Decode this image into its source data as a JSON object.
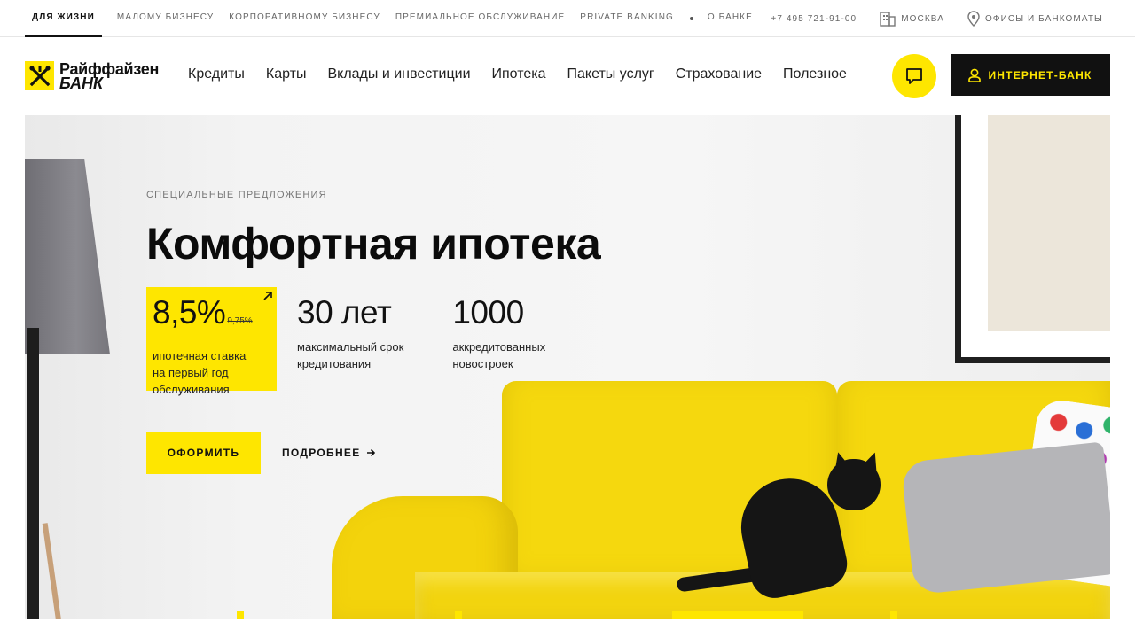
{
  "topbar": {
    "nav": [
      {
        "label": "Для жизни",
        "active": true
      },
      {
        "label": "Малому бизнесу"
      },
      {
        "label": "Корпоративному бизнесу"
      },
      {
        "label": "Премиальное обслуживание"
      },
      {
        "label": "Private Banking"
      },
      {
        "label": "О банке"
      }
    ],
    "phone": "+7 495 721-91-00",
    "city": "Москва",
    "offices": "Офисы и банкоматы"
  },
  "header": {
    "logo": {
      "line1": "Райффайзен",
      "line2": "БАНК"
    },
    "nav": [
      "Кредиты",
      "Карты",
      "Вклады и инвестиции",
      "Ипотека",
      "Пакеты услуг",
      "Страхование",
      "Полезное"
    ],
    "internet_bank": "Интернет-банк"
  },
  "hero": {
    "eyebrow": "Специальные предложения",
    "title": "Комфортная ипотека",
    "stats": [
      {
        "value": "8,5%",
        "old_value": "9,75%",
        "desc_lines": [
          "ипотечная ставка",
          "на первый год",
          "обслуживания"
        ]
      },
      {
        "value": "30 лет",
        "desc_lines": [
          "максимальный срок",
          "кредитования"
        ]
      },
      {
        "value": "1000",
        "desc_lines": [
          "аккредитованных",
          "новостроек"
        ]
      }
    ],
    "apply_button": "Оформить",
    "more_link": "Подробнее"
  },
  "colors": {
    "brand_yellow": "#fee600",
    "dark": "#111111"
  },
  "icons": {
    "logo": "raiffeisen-logo-icon",
    "city": "building-icon",
    "offices": "map-pin-icon",
    "chat": "chat-icon",
    "user": "user-icon",
    "arrow_more": "arrow-right-icon",
    "stat_link": "arrow-up-right-icon"
  }
}
